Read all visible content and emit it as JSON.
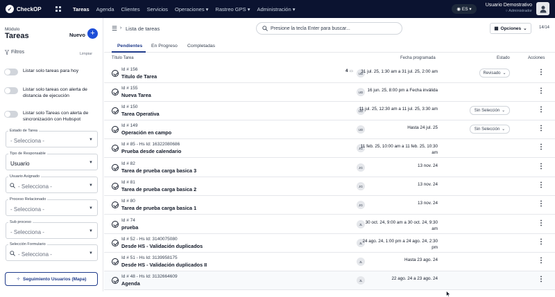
{
  "app": {
    "brand": "CheckOP"
  },
  "nav": [
    "Tareas",
    "Agenda",
    "Clientes",
    "Servicios",
    "Operaciones ▾",
    "Rastreo GPS ▾",
    "Administración ▾"
  ],
  "lang": "ES ▾",
  "user": {
    "name": "Usuario Demostrativo",
    "role": "Administrador"
  },
  "sidebar": {
    "module_label": "Módulo",
    "module_title": "Tareas",
    "new_label": "Nuevo",
    "filters_label": "Filtros",
    "clear_label": "Limpiar",
    "toggles": [
      "Listar solo tareas para hoy",
      "Listar solo tareas con alerta de distancia de ejecución",
      "Listar solo Tareas con alerta de sincronización con Hubspot"
    ],
    "fields": [
      {
        "label": "Estado de Tarea",
        "value": "- Selecciona -"
      },
      {
        "label": "Tipo de Responsable",
        "value": "Usuario"
      },
      {
        "label": "Usuario Asignado",
        "value": "- Selecciona -"
      },
      {
        "label": "Proceso Relacionado",
        "value": "- Selecciona -"
      },
      {
        "label": "Sub proceso",
        "value": "- Selecciona -"
      },
      {
        "label": "Selección Formulario",
        "value": "- Selecciona -"
      }
    ],
    "map_button": "Seguimiento Usuarios (Mapa)"
  },
  "main": {
    "breadcrumb": "Lista de tareas",
    "search_placeholder": "Presione la tecla Enter para buscar...",
    "options_label": "Opciones",
    "pager": "14/14",
    "tabs": [
      "Pendientes",
      "En Progreso",
      "Completadas"
    ],
    "columns": {
      "title": "Título Tarea",
      "date": "Fecha programada",
      "state": "Estado",
      "actions": "Acciones"
    }
  },
  "rows": [
    {
      "id": "Id # 156",
      "title": "Titulo de Tarea",
      "count": "4",
      "badge": "UD",
      "date1": "31 jul. 25, 1:30 am a 31 jul. 25, 2:00 am",
      "date2": "",
      "state": "Revisado"
    },
    {
      "id": "Id # 155",
      "title": "Nueva Tarea",
      "count": "",
      "badge": "UD",
      "date1": "16 jun. 25, 8:00 pm a Fecha inválida",
      "date2": "",
      "state": ""
    },
    {
      "id": "Id # 150",
      "title": "Tarea Operativa",
      "count": "",
      "badge": "UD",
      "date1": "11 jul. 25, 12:30 am a 11 jul. 25, 3:30 am",
      "date2": "",
      "state": "Sin Selección"
    },
    {
      "id": "Id # 149",
      "title": "Operación en campo",
      "count": "",
      "badge": "UD",
      "date1": "Hasta 24 jul. 25",
      "date2": "",
      "state": "Sin Selección"
    },
    {
      "id": "Id # 85 - Hs Id: 16322080686",
      "title": "Prueba desde calendario",
      "count": "",
      "badge": "JG",
      "date1": "11 feb. 25, 10:00 am a 11 feb. 25, 10:30",
      "date2": "am",
      "state": ""
    },
    {
      "id": "Id # 82",
      "title": "Tarea de prueba carga basica 3",
      "count": "",
      "badge": "JG",
      "date1": "13 nov. 24",
      "date2": "",
      "state": ""
    },
    {
      "id": "Id # 81",
      "title": "Tarea de prueba carga basica 2",
      "count": "",
      "badge": "JG",
      "date1": "13 nov. 24",
      "date2": "",
      "state": ""
    },
    {
      "id": "Id # 80",
      "title": "Tarea de prueba carga basica 1",
      "count": "",
      "badge": "JG",
      "date1": "13 nov. 24",
      "date2": "",
      "state": ""
    },
    {
      "id": "Id # 74",
      "title": "prueba",
      "count": "",
      "badge": "JL",
      "date1": "30 oct. 24, 9:00 am a 30 oct. 24, 9:30",
      "date2": "am",
      "state": ""
    },
    {
      "id": "Id # 52 - Hs Id: 3140075080",
      "title": "Desde HS - Validación duplicados",
      "count": "",
      "badge": "JL",
      "date1": "24 ago. 24, 1:00 pm a 24 ago. 24, 2:30",
      "date2": "pm",
      "state": ""
    },
    {
      "id": "Id # 51 - Hs Id: 3139958175",
      "title": "Desde HS - Validación duplicados II",
      "count": "",
      "badge": "JL",
      "date1": "Hasta 23 ago. 24",
      "date2": "",
      "state": ""
    },
    {
      "id": "Id # 48 - Hs Id: 3132664609",
      "title": "Agenda",
      "count": "",
      "badge": "JL",
      "date1": "22 ago. 24 a 23 ago. 24",
      "date2": "",
      "state": ""
    }
  ]
}
